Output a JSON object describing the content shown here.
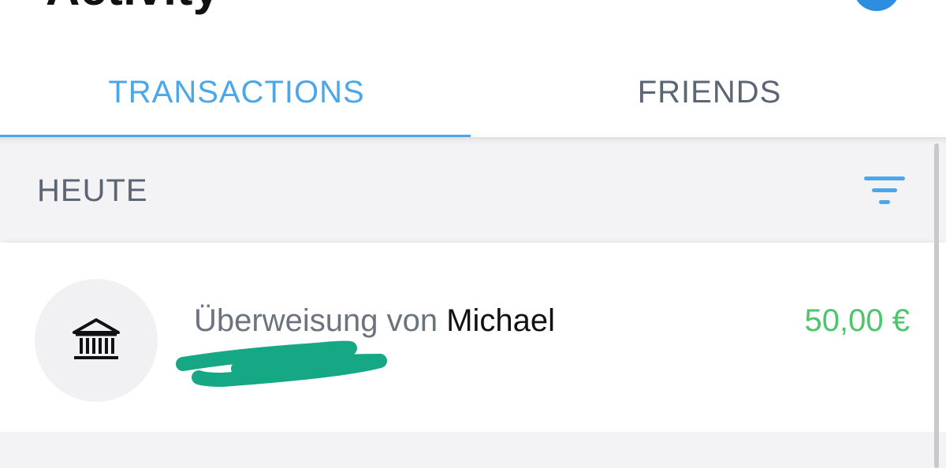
{
  "header": {
    "title": "Activity"
  },
  "tabs": [
    {
      "label": "TRANSACTIONS",
      "active": true
    },
    {
      "label": "FRIENDS",
      "active": false
    }
  ],
  "section": {
    "title": "HEUTE",
    "filter_icon": "filter-icon"
  },
  "transactions": [
    {
      "icon": "bank-icon",
      "description_prefix": "Überweisung von",
      "name": "Michael",
      "amount": "50,00 €"
    }
  ],
  "colors": {
    "accent": "#4aa8ea",
    "positive_amount": "#4cc56b",
    "redaction": "#16a785",
    "muted_text": "#5c6573"
  }
}
